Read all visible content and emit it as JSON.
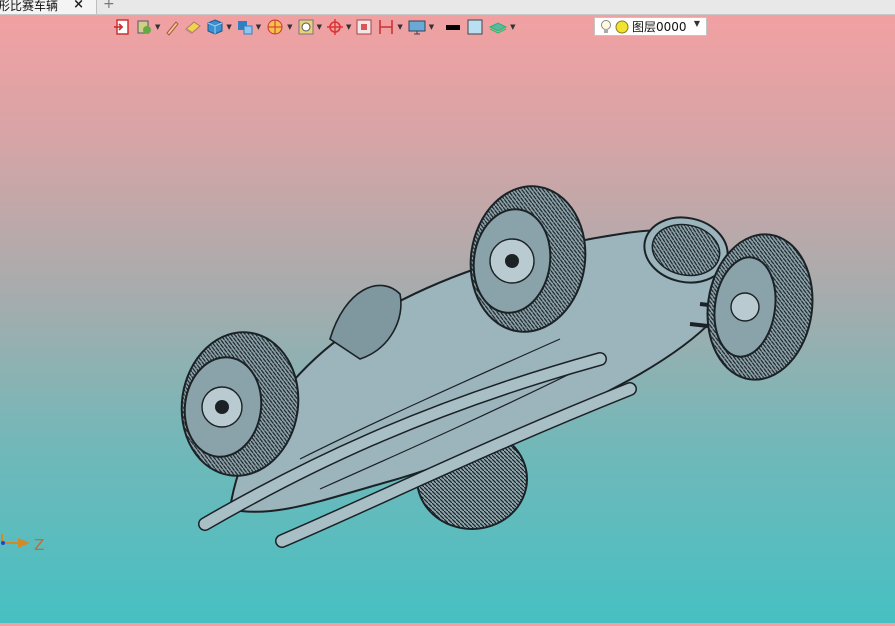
{
  "tab": {
    "title": "形比赛车辆",
    "close_glyph": "×",
    "new_tab_glyph": "+"
  },
  "toolbar": {
    "items": [
      {
        "name": "exit-icon",
        "dropdown": false
      },
      {
        "name": "render-mode-icon",
        "dropdown": true
      },
      {
        "name": "pencil-icon",
        "dropdown": false
      },
      {
        "name": "eraser-icon",
        "dropdown": false
      },
      {
        "name": "cube-shaded-icon",
        "dropdown": true
      },
      {
        "name": "view-orient-icon",
        "dropdown": true
      },
      {
        "name": "section-icon",
        "dropdown": true
      },
      {
        "name": "fit-view-icon",
        "dropdown": true
      },
      {
        "name": "target-icon",
        "dropdown": true
      },
      {
        "name": "frame-icon",
        "dropdown": false
      },
      {
        "name": "dimension-icon",
        "dropdown": true
      },
      {
        "name": "display-icon",
        "dropdown": true
      },
      {
        "name": "line-color-icon",
        "dropdown": false
      },
      {
        "name": "fill-color-icon",
        "dropdown": false
      },
      {
        "name": "layer-stack-icon",
        "dropdown": true
      }
    ],
    "dropdown_glyph": "▼"
  },
  "layer": {
    "name": "图层0000",
    "dropdown_glyph": "▼"
  },
  "axis": {
    "z_label": "Z"
  },
  "colors": {
    "model": "#9cb4bc",
    "edge": "#1b2226",
    "tire": "#232a2e",
    "bg_top": "#f5a0a2",
    "bg_bottom": "#46c0c2"
  }
}
